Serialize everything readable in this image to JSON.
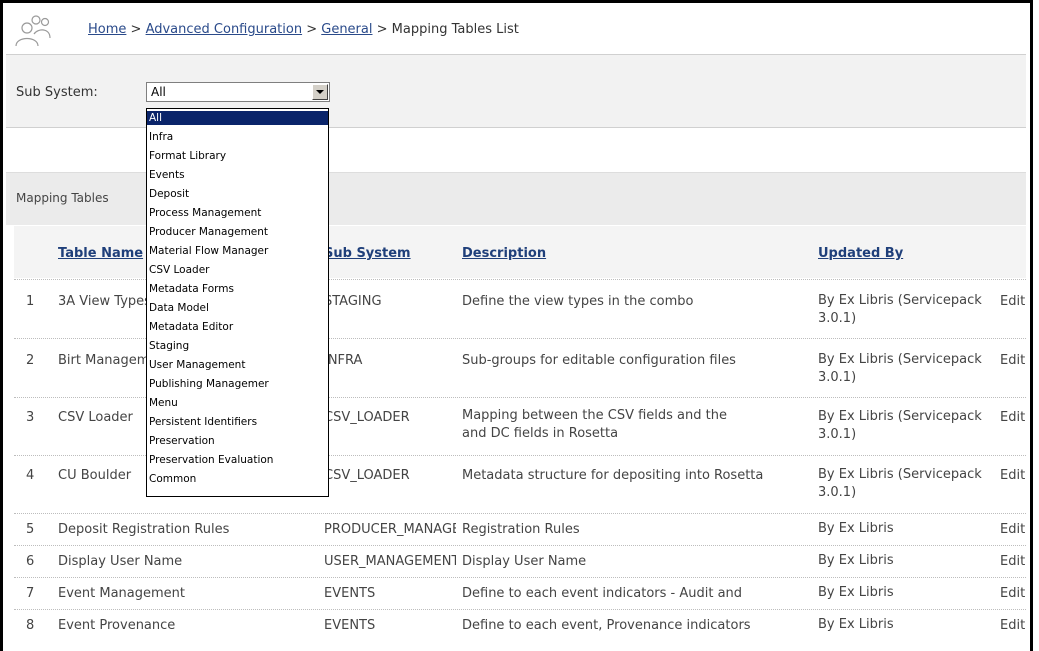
{
  "breadcrumb": {
    "home": "Home",
    "sep1": " > ",
    "advanced": "Advanced Configuration",
    "sep2": " > ",
    "general": "General",
    "sep3": " > ",
    "current": "Mapping Tables List"
  },
  "filter": {
    "label": "Sub System:",
    "selected": "All",
    "options": [
      "All",
      "Infra",
      "Format Library",
      "Events",
      "Deposit",
      "Process Management",
      "Producer Management",
      "Material Flow Manager",
      "CSV Loader",
      "Metadata Forms",
      "Data Model",
      "Metadata Editor",
      "Staging",
      "User Management",
      "Publishing Managemer",
      "Menu",
      "Persistent Identifiers",
      "Preservation",
      "Preservation Evaluation",
      "Common"
    ]
  },
  "caption": "Mapping Tables",
  "table": {
    "headers": {
      "name": "Table Name",
      "subsystem": "Sub System",
      "description": "Description",
      "updated_by": "Updated By"
    },
    "rows": [
      {
        "num": "1",
        "name": "3A View Types",
        "subsystem": "STAGING",
        "description": "Define the view types in the combo",
        "updated_by": "By Ex Libris (Servicepack 3.0.1)",
        "action": "Edit"
      },
      {
        "num": "2",
        "name": "Birt Management",
        "subsystem": "INFRA",
        "description": "Sub-groups for editable configuration files",
        "updated_by": "By Ex Libris (Servicepack 3.0.1)",
        "action": "Edit"
      },
      {
        "num": "3",
        "name": "CSV Loader",
        "subsystem": "CSV_LOADER",
        "description": "Mapping between the CSV fields and the",
        "description2": "and DC fields in Rosetta",
        "updated_by": "By Ex Libris (Servicepack 3.0.1)",
        "action": "Edit"
      },
      {
        "num": "4",
        "name": "CU Boulder",
        "subsystem": "CSV_LOADER",
        "description": "Metadata structure for depositing into Rosetta",
        "updated_by": "By Ex Libris (Servicepack 3.0.1)",
        "action": "Edit"
      },
      {
        "num": "5",
        "name": "Deposit Registration Rules",
        "subsystem": "PRODUCER_MANAGEMENT",
        "description": "Registration Rules",
        "updated_by": "By Ex Libris",
        "action": "Edit"
      },
      {
        "num": "6",
        "name": "Display User Name",
        "subsystem": "USER_MANAGEMENT",
        "description": "Display User Name",
        "updated_by": "By Ex Libris",
        "action": "Edit"
      },
      {
        "num": "7",
        "name": "Event Management",
        "subsystem": "EVENTS",
        "description": "Define to each event indicators - Audit and",
        "updated_by": "By Ex Libris",
        "action": "Edit"
      },
      {
        "num": "8",
        "name": "Event Provenance",
        "subsystem": "EVENTS",
        "description": "Define to each event, Provenance indicators",
        "updated_by": "By Ex Libris",
        "action": "Edit"
      }
    ]
  }
}
